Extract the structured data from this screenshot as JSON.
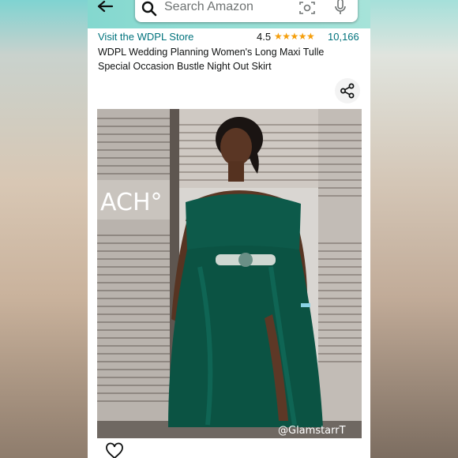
{
  "search": {
    "placeholder": "Search Amazon"
  },
  "store": {
    "link_text": "Visit the WDPL Store",
    "rating": "4.5",
    "stars": "★★★★★",
    "review_count": "10,166"
  },
  "product": {
    "title": "WDPL Wedding Planning Women's Long Maxi Tulle Special Occasion Bustle Night Out Skirt"
  },
  "image": {
    "watermark": "@GlamstarrT",
    "sign_text": "ACH°"
  },
  "icons": {
    "back": "back-arrow-icon",
    "search": "search-icon",
    "camera": "camera-icon",
    "mic": "mic-icon",
    "share": "share-icon",
    "wishlist": "heart-icon"
  },
  "colors": {
    "header": "#8fd9cf",
    "link": "#00727c",
    "star": "#f59e0b",
    "dress": "#0d5a4a"
  }
}
